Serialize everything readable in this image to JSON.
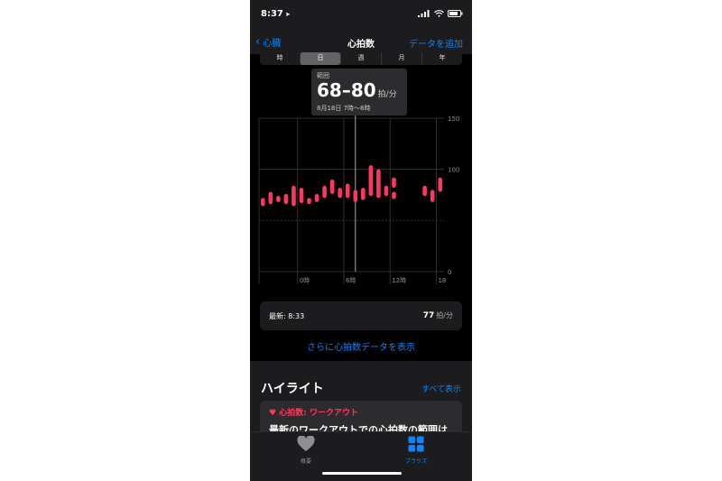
{
  "status": {
    "time": "8:37",
    "location_icon": "location-arrow-icon"
  },
  "nav": {
    "back_label": "心臓",
    "title": "心拍数",
    "add_label": "データを追加"
  },
  "segments": [
    {
      "label": "時",
      "selected": false
    },
    {
      "label": "日",
      "selected": true
    },
    {
      "label": "週",
      "selected": false
    },
    {
      "label": "月",
      "selected": false
    },
    {
      "label": "年",
      "selected": false
    }
  ],
  "tooltip": {
    "label": "範囲",
    "value": "68–80",
    "unit": "拍/分",
    "date": "8月18日 7時〜8時"
  },
  "chart_data": {
    "type": "bar",
    "y_ticks": [
      "150",
      "100",
      "0"
    ],
    "x_ticks": [
      "0時",
      "6時",
      "12時",
      "18"
    ],
    "ylim": [
      0,
      150
    ],
    "xlim": [
      -5,
      19
    ],
    "selected_hour": 7.5,
    "grid": true,
    "color": "#ff375f",
    "ranges": [
      {
        "hour": -4.5,
        "low": 64,
        "high": 72
      },
      {
        "hour": -3.5,
        "low": 66,
        "high": 78
      },
      {
        "hour": -2.5,
        "low": 68,
        "high": 74
      },
      {
        "hour": -1.5,
        "low": 66,
        "high": 76
      },
      {
        "hour": -0.5,
        "low": 64,
        "high": 84
      },
      {
        "hour": 0.5,
        "low": 67,
        "high": 82
      },
      {
        "hour": 1.5,
        "low": 66,
        "high": 72
      },
      {
        "hour": 2.5,
        "low": 68,
        "high": 76
      },
      {
        "hour": 3.5,
        "low": 72,
        "high": 84
      },
      {
        "hour": 4.5,
        "low": 76,
        "high": 90
      },
      {
        "hour": 5.5,
        "low": 72,
        "high": 82
      },
      {
        "hour": 6.5,
        "low": 72,
        "high": 86
      },
      {
        "hour": 7.5,
        "low": 68,
        "high": 80
      },
      {
        "hour": 8.5,
        "low": 70,
        "high": 82
      },
      {
        "hour": 9.5,
        "low": 74,
        "high": 104
      },
      {
        "hour": 10.5,
        "low": 72,
        "high": 100
      },
      {
        "hour": 11.5,
        "low": 74,
        "high": 84
      },
      {
        "hour": 12.5,
        "low": 71,
        "high": 78
      },
      {
        "hour": 12.5,
        "low": 82,
        "high": 92
      },
      {
        "hour": 16.5,
        "low": 74,
        "high": 84
      },
      {
        "hour": 17.5,
        "low": 68,
        "high": 80
      },
      {
        "hour": 18.5,
        "low": 78,
        "high": 92
      }
    ]
  },
  "latest": {
    "label": "最新: 8:33",
    "value": "77",
    "unit": "拍/分"
  },
  "more_link": "さらに心拍数データを表示",
  "highlights": {
    "title": "ハイライト",
    "show_all": "すべて表示",
    "card_heading": "心拍数: ワークアウト",
    "card_text": "最新のワークアウトでの心拍数の範囲は"
  },
  "tabs": [
    {
      "label": "概要",
      "icon": "heart-icon",
      "active": false
    },
    {
      "label": "ブラウズ",
      "icon": "grid-icon",
      "active": true
    }
  ],
  "colors": {
    "accent": "#0a84ff",
    "heart": "#ff375f",
    "background": "#000000",
    "card": "#1c1c1e"
  }
}
